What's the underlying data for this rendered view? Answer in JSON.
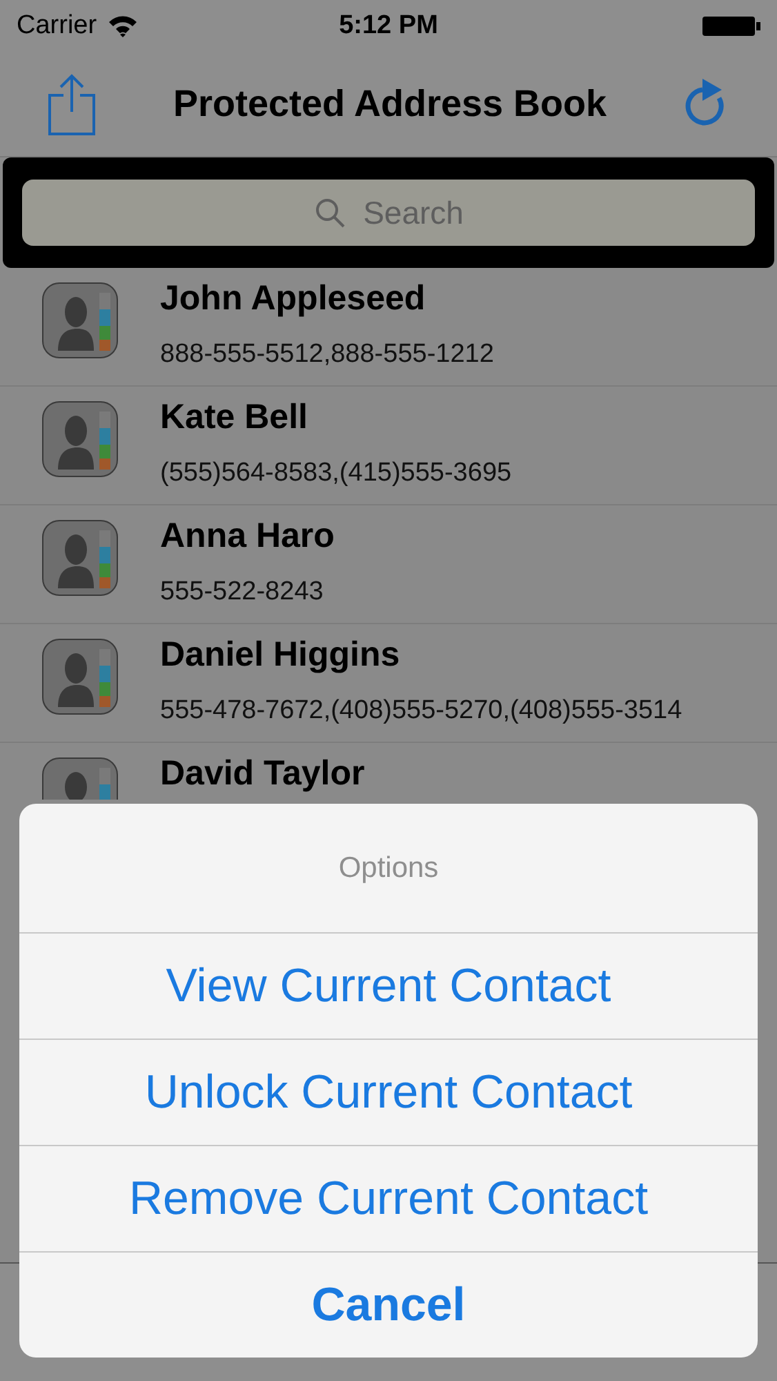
{
  "status_bar": {
    "carrier": "Carrier",
    "time": "5:12 PM"
  },
  "nav_bar": {
    "title": "Protected Address Book"
  },
  "search": {
    "placeholder": "Search"
  },
  "contacts": [
    {
      "name": "John Appleseed",
      "phones": "888-555-5512,888-555-1212"
    },
    {
      "name": "Kate Bell",
      "phones": "(555)564-8583,(415)555-3695"
    },
    {
      "name": "Anna Haro",
      "phones": "555-522-8243"
    },
    {
      "name": "Daniel Higgins",
      "phones": "555-478-7672,(408)555-5270,(408)555-3514"
    },
    {
      "name": "David Taylor"
    }
  ],
  "action_sheet": {
    "title": "Options",
    "actions": [
      {
        "label": "View Current Contact",
        "kind": "default"
      },
      {
        "label": "Unlock Current Contact",
        "kind": "default"
      },
      {
        "label": "Remove Current Contact",
        "kind": "default"
      },
      {
        "label": "Cancel",
        "kind": "cancel"
      }
    ]
  }
}
